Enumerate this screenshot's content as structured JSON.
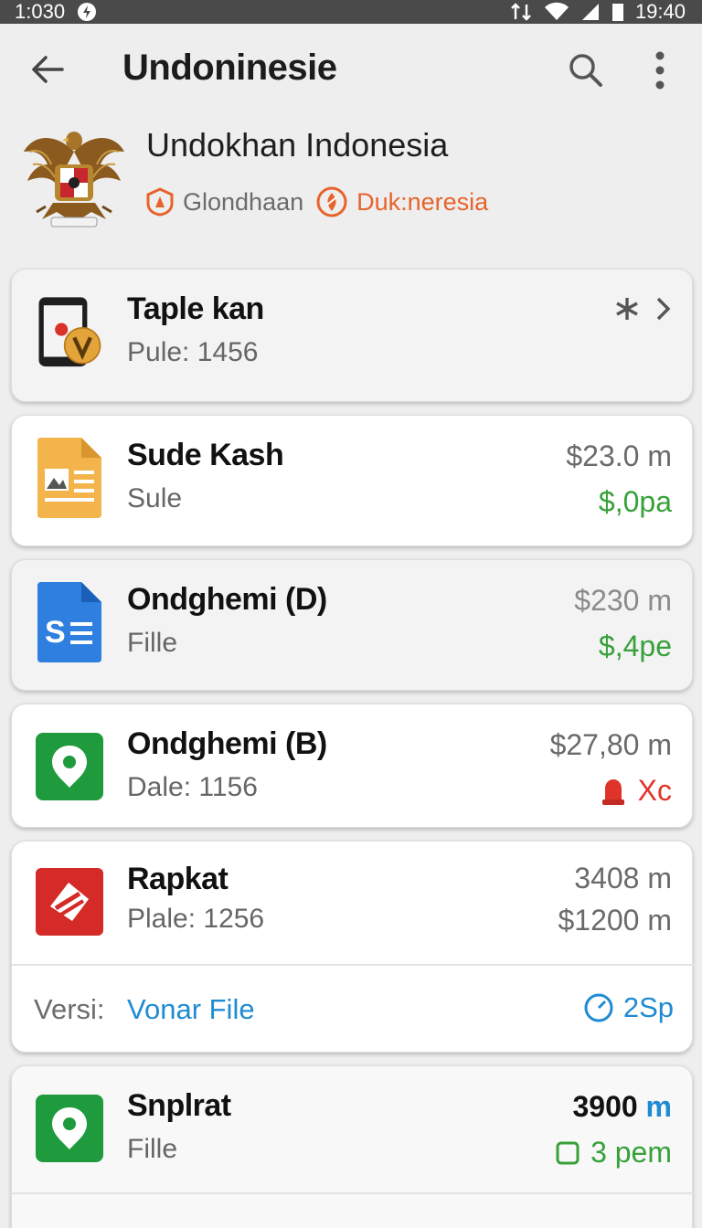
{
  "status_bar": {
    "time_left": "1:030",
    "time_right": "19:40"
  },
  "app_bar": {
    "title": "Undoninesie"
  },
  "header": {
    "title": "Undokhan Indonesia",
    "meta1": "Glondhaan",
    "meta2": "Duk:neresia"
  },
  "items": [
    {
      "title": "Taple kan",
      "subtitle": "Pule: 1456"
    },
    {
      "title": "Sude Kash",
      "subtitle": "Sule",
      "value1": "$23.0 m",
      "value2": "$,0pa"
    },
    {
      "title": "Ondghemi (D)",
      "subtitle": "Fille",
      "value1": "$230 m",
      "value2": "$,4pe"
    },
    {
      "title": "Ondghemi (B)",
      "subtitle": "Dale: 1156",
      "value1": "$27,80 m",
      "value2": "Xc"
    },
    {
      "title": "Rapkat",
      "subtitle": "Plale: 1256",
      "value1": "3408 m",
      "value2": "$1200 m"
    },
    {
      "title": "Snplrat",
      "subtitle": "Fille",
      "value1_num": "3900",
      "value1_unit": "m",
      "value2": "3 pem"
    }
  ],
  "version_row": {
    "label": "Versi:",
    "link": "Vonar File",
    "meta": "2Sp"
  },
  "colors": {
    "accent_blue": "#1f8bd2",
    "green": "#37a13a",
    "red": "#e0342a",
    "status_bar": "#4a4a4a"
  }
}
